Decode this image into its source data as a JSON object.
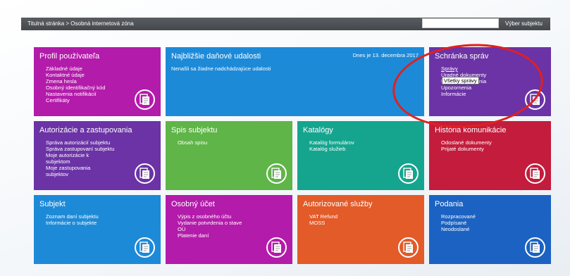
{
  "topbar": {
    "breadcrumb": "Titulná stránka > Osobná internetová zóna",
    "search_value": "",
    "select_subject": "Výber subjektu"
  },
  "tiles": [
    {
      "title": "Profil používateľa",
      "color": "#b31baa",
      "items": [
        "Základné údaje",
        "Kontaktné údaje",
        "Zmena hesla",
        "Osobný identifikačný kód",
        "Nastavenia notifikácií",
        "Certifikáty"
      ]
    },
    {
      "title": "Najbližšie daňové udalosti",
      "color": "#1d8ad8",
      "date": "Dnes je 13. decembra 2017",
      "items": [
        "Nenašli sa žiadne nadchádzajúce udalosti"
      ]
    },
    {
      "title": "Schránka správ",
      "color": "#6b33a6",
      "items": [
        "Správy",
        "Úradné dokumenty",
        "Úradné oznámenia",
        "Upozornenia",
        "Informácie"
      ],
      "tooltip": "Všetky správy"
    },
    {
      "title": "Autorizácie a zastupovania",
      "color": "#6b33a6",
      "items": [
        "Správa autorizácií subjektu",
        "Správa zastupovaní subjektu",
        "Moje autorizácie k subjektom",
        "Moje zastupovania subjektov"
      ]
    },
    {
      "title": "Spis subjektu",
      "color": "#5fb547",
      "items": [
        "Obsah spisu"
      ]
    },
    {
      "title": "Katalógy",
      "color": "#15a58f",
      "items": [
        "Katalóg formulárov",
        "Katalóg služieb"
      ]
    },
    {
      "title": "História komunikácie",
      "color": "#c31c3c",
      "items": [
        "Odoslané dokumenty",
        "Prijaté dokumenty"
      ]
    },
    {
      "title": "Subjekt",
      "color": "#1d8ad8",
      "items": [
        "Zoznam daní subjektu",
        "Informácie o subjekte"
      ]
    },
    {
      "title": "Osobný účet",
      "color": "#b31baa",
      "items": [
        "Výpis z osobného účtu",
        "Vydanie potvrdenia o stave OÚ",
        "Platenie daní"
      ]
    },
    {
      "title": "Autorizované služby",
      "color": "#e25b28",
      "items": [
        "VAT Refund",
        "MOSS"
      ]
    },
    {
      "title": "Podania",
      "color": "#1b62c2",
      "items": [
        "Rozpracované",
        "Podpísané",
        "Neodoslané"
      ]
    }
  ],
  "icon": "document-icon",
  "annotation": {
    "shape": "ellipse",
    "color": "#e1201f"
  }
}
